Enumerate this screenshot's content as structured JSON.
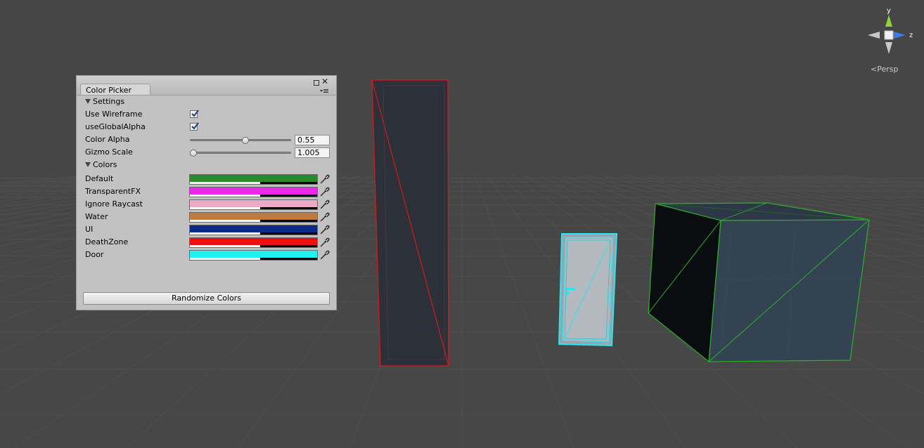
{
  "scene": {
    "gizmo": {
      "axis_y": "y",
      "axis_z": "z",
      "projection_label": "Persp",
      "y_color": "#8fd43a",
      "z_color": "#3c7be8"
    },
    "objects": [
      {
        "name": "tall-box",
        "layer": "DeathZone",
        "wire_color": "#e21a1a"
      },
      {
        "name": "door",
        "layer": "Door",
        "wire_color": "#26e8ee"
      },
      {
        "name": "cube",
        "layer": "Default",
        "wire_color": "#2bbd2b"
      }
    ]
  },
  "window": {
    "tab_title": "Color Picker",
    "settings": {
      "header": "Settings",
      "use_wireframe": {
        "label": "Use Wireframe",
        "checked": true
      },
      "use_global_alpha": {
        "label": "useGlobalAlpha",
        "checked": true
      },
      "color_alpha": {
        "label": "Color Alpha",
        "value": "0.55",
        "fraction": 0.55
      },
      "gizmo_scale": {
        "label": "Gizmo Scale",
        "value": "1.005",
        "fraction": 0.0
      }
    },
    "colors": {
      "header": "Colors",
      "items": [
        {
          "label": "Default",
          "color": "#2b8a2b"
        },
        {
          "label": "TransparentFX",
          "color": "#ec27ec"
        },
        {
          "label": "Ignore Raycast",
          "color": "#ecaac8"
        },
        {
          "label": "Water",
          "color": "#bf7b3e"
        },
        {
          "label": "UI",
          "color": "#0b2b8a"
        },
        {
          "label": "DeathZone",
          "color": "#ea1111"
        },
        {
          "label": "Door",
          "color": "#1ff2f2"
        }
      ]
    },
    "randomize_label": "Randomize Colors"
  }
}
